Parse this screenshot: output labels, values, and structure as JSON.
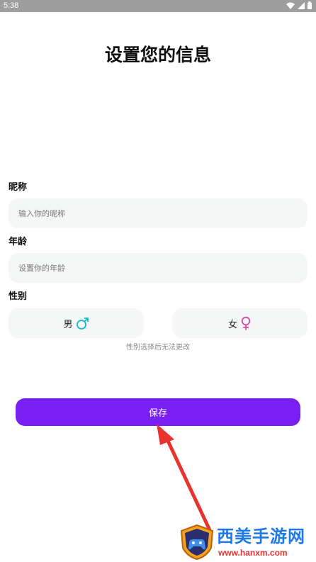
{
  "status_bar": {
    "time": "5:38"
  },
  "title": "设置您的信息",
  "nickname": {
    "label": "昵称",
    "placeholder": "输入你的昵称",
    "value": ""
  },
  "age": {
    "label": "年龄",
    "placeholder": "设置你的年龄",
    "value": ""
  },
  "gender": {
    "label": "性别",
    "male_label": "男",
    "female_label": "女",
    "note": "性别选择后无法更改",
    "male_icon": "male-symbol-icon",
    "female_icon": "female-symbol-icon",
    "male_color": "#15b8c6",
    "female_color": "#d648a6"
  },
  "save_label": "保存",
  "colors": {
    "accent": "#7a1ff2",
    "annotation_arrow": "#e8332e"
  },
  "watermark": {
    "text": "西美手游网",
    "url": "www.hanxm.com"
  }
}
